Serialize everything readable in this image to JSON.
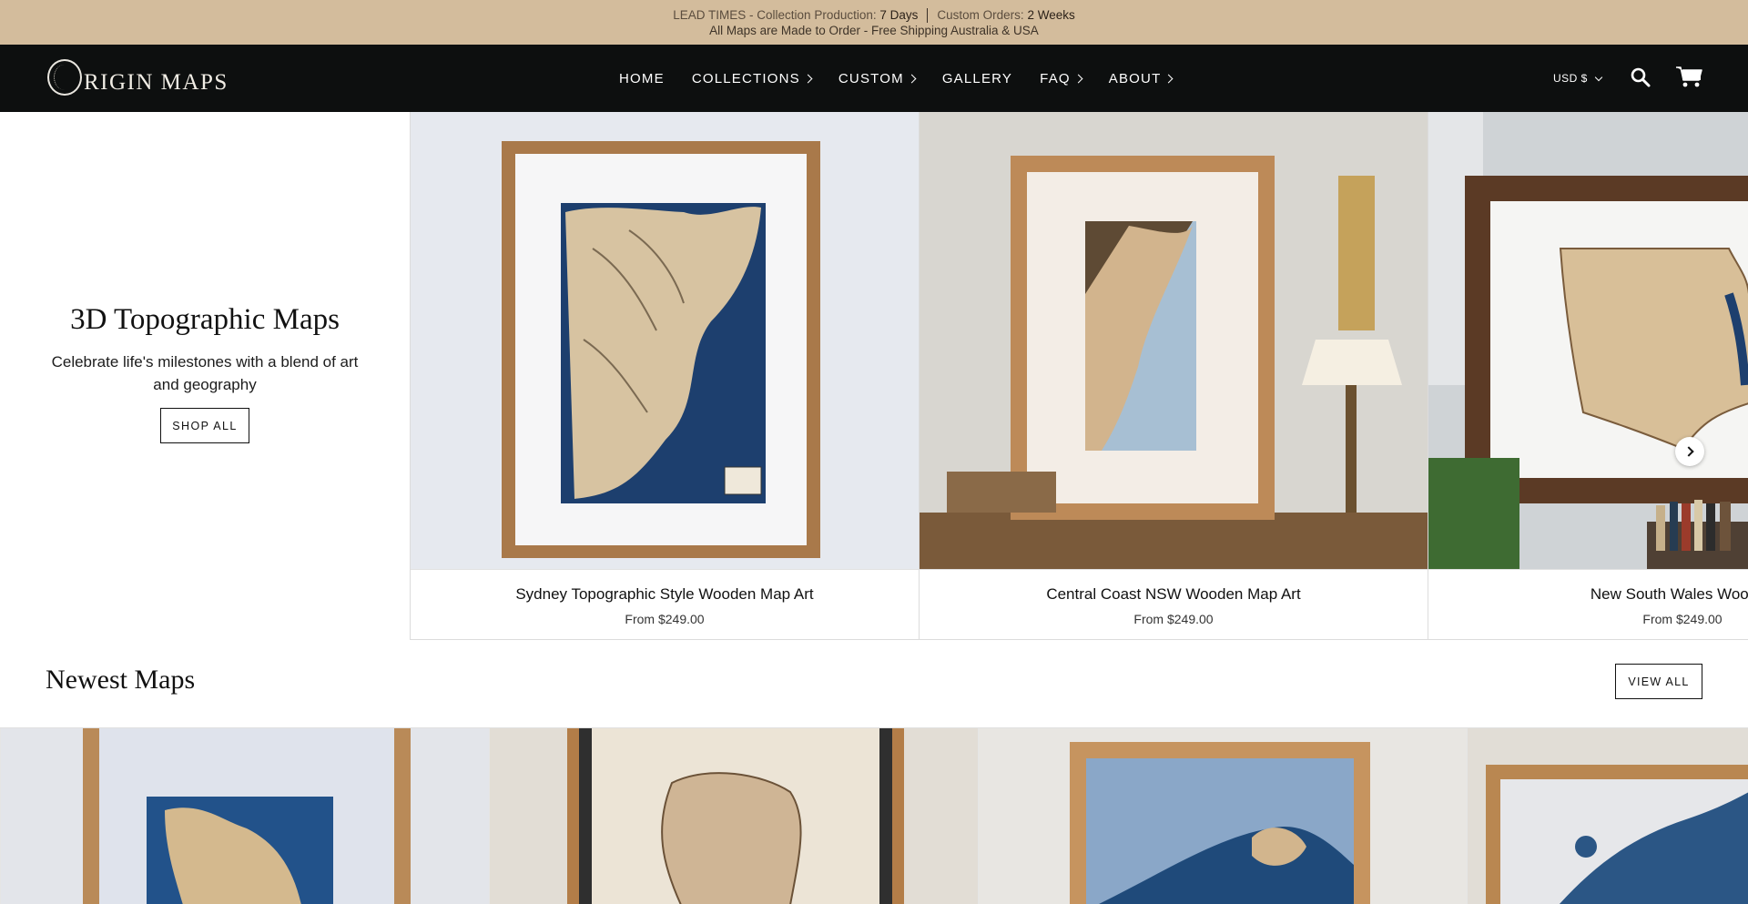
{
  "announcement": {
    "lead_prefix": "LEAD TIMES - Collection Production:",
    "lead_value": "7 Days",
    "custom_prefix": "Custom Orders:",
    "custom_value": "2 Weeks",
    "line2": "All Maps are Made to Order - Free Shipping Australia & USA"
  },
  "header": {
    "logo_text": "RIGIN MAPS",
    "nav": [
      {
        "label": "HOME",
        "has_dropdown": false
      },
      {
        "label": "COLLECTIONS",
        "has_dropdown": true
      },
      {
        "label": "CUSTOM",
        "has_dropdown": true
      },
      {
        "label": "GALLERY",
        "has_dropdown": false
      },
      {
        "label": "FAQ",
        "has_dropdown": true
      },
      {
        "label": "ABOUT",
        "has_dropdown": true
      }
    ],
    "currency": "USD $",
    "icons": [
      "search-icon",
      "cart-icon"
    ]
  },
  "hero": {
    "title": "3D Topographic Maps",
    "subtitle": "Celebrate life's milestones with a blend of art and geography",
    "button": "SHOP ALL",
    "products": [
      {
        "title": "Sydney Topographic Style Wooden Map Art",
        "price": "From $249.00"
      },
      {
        "title": "Central Coast NSW Wooden Map Art",
        "price": "From $249.00"
      },
      {
        "title": "New South Wales Wooden",
        "price": "From $249.00"
      }
    ]
  },
  "newest": {
    "title": "Newest Maps",
    "button": "VIEW ALL"
  },
  "colors": {
    "announcement_bg": "#d3bc9c",
    "header_bg": "#0d0f0f",
    "ocean_blue": "#1f4a7a",
    "wood": "#b0814f"
  }
}
